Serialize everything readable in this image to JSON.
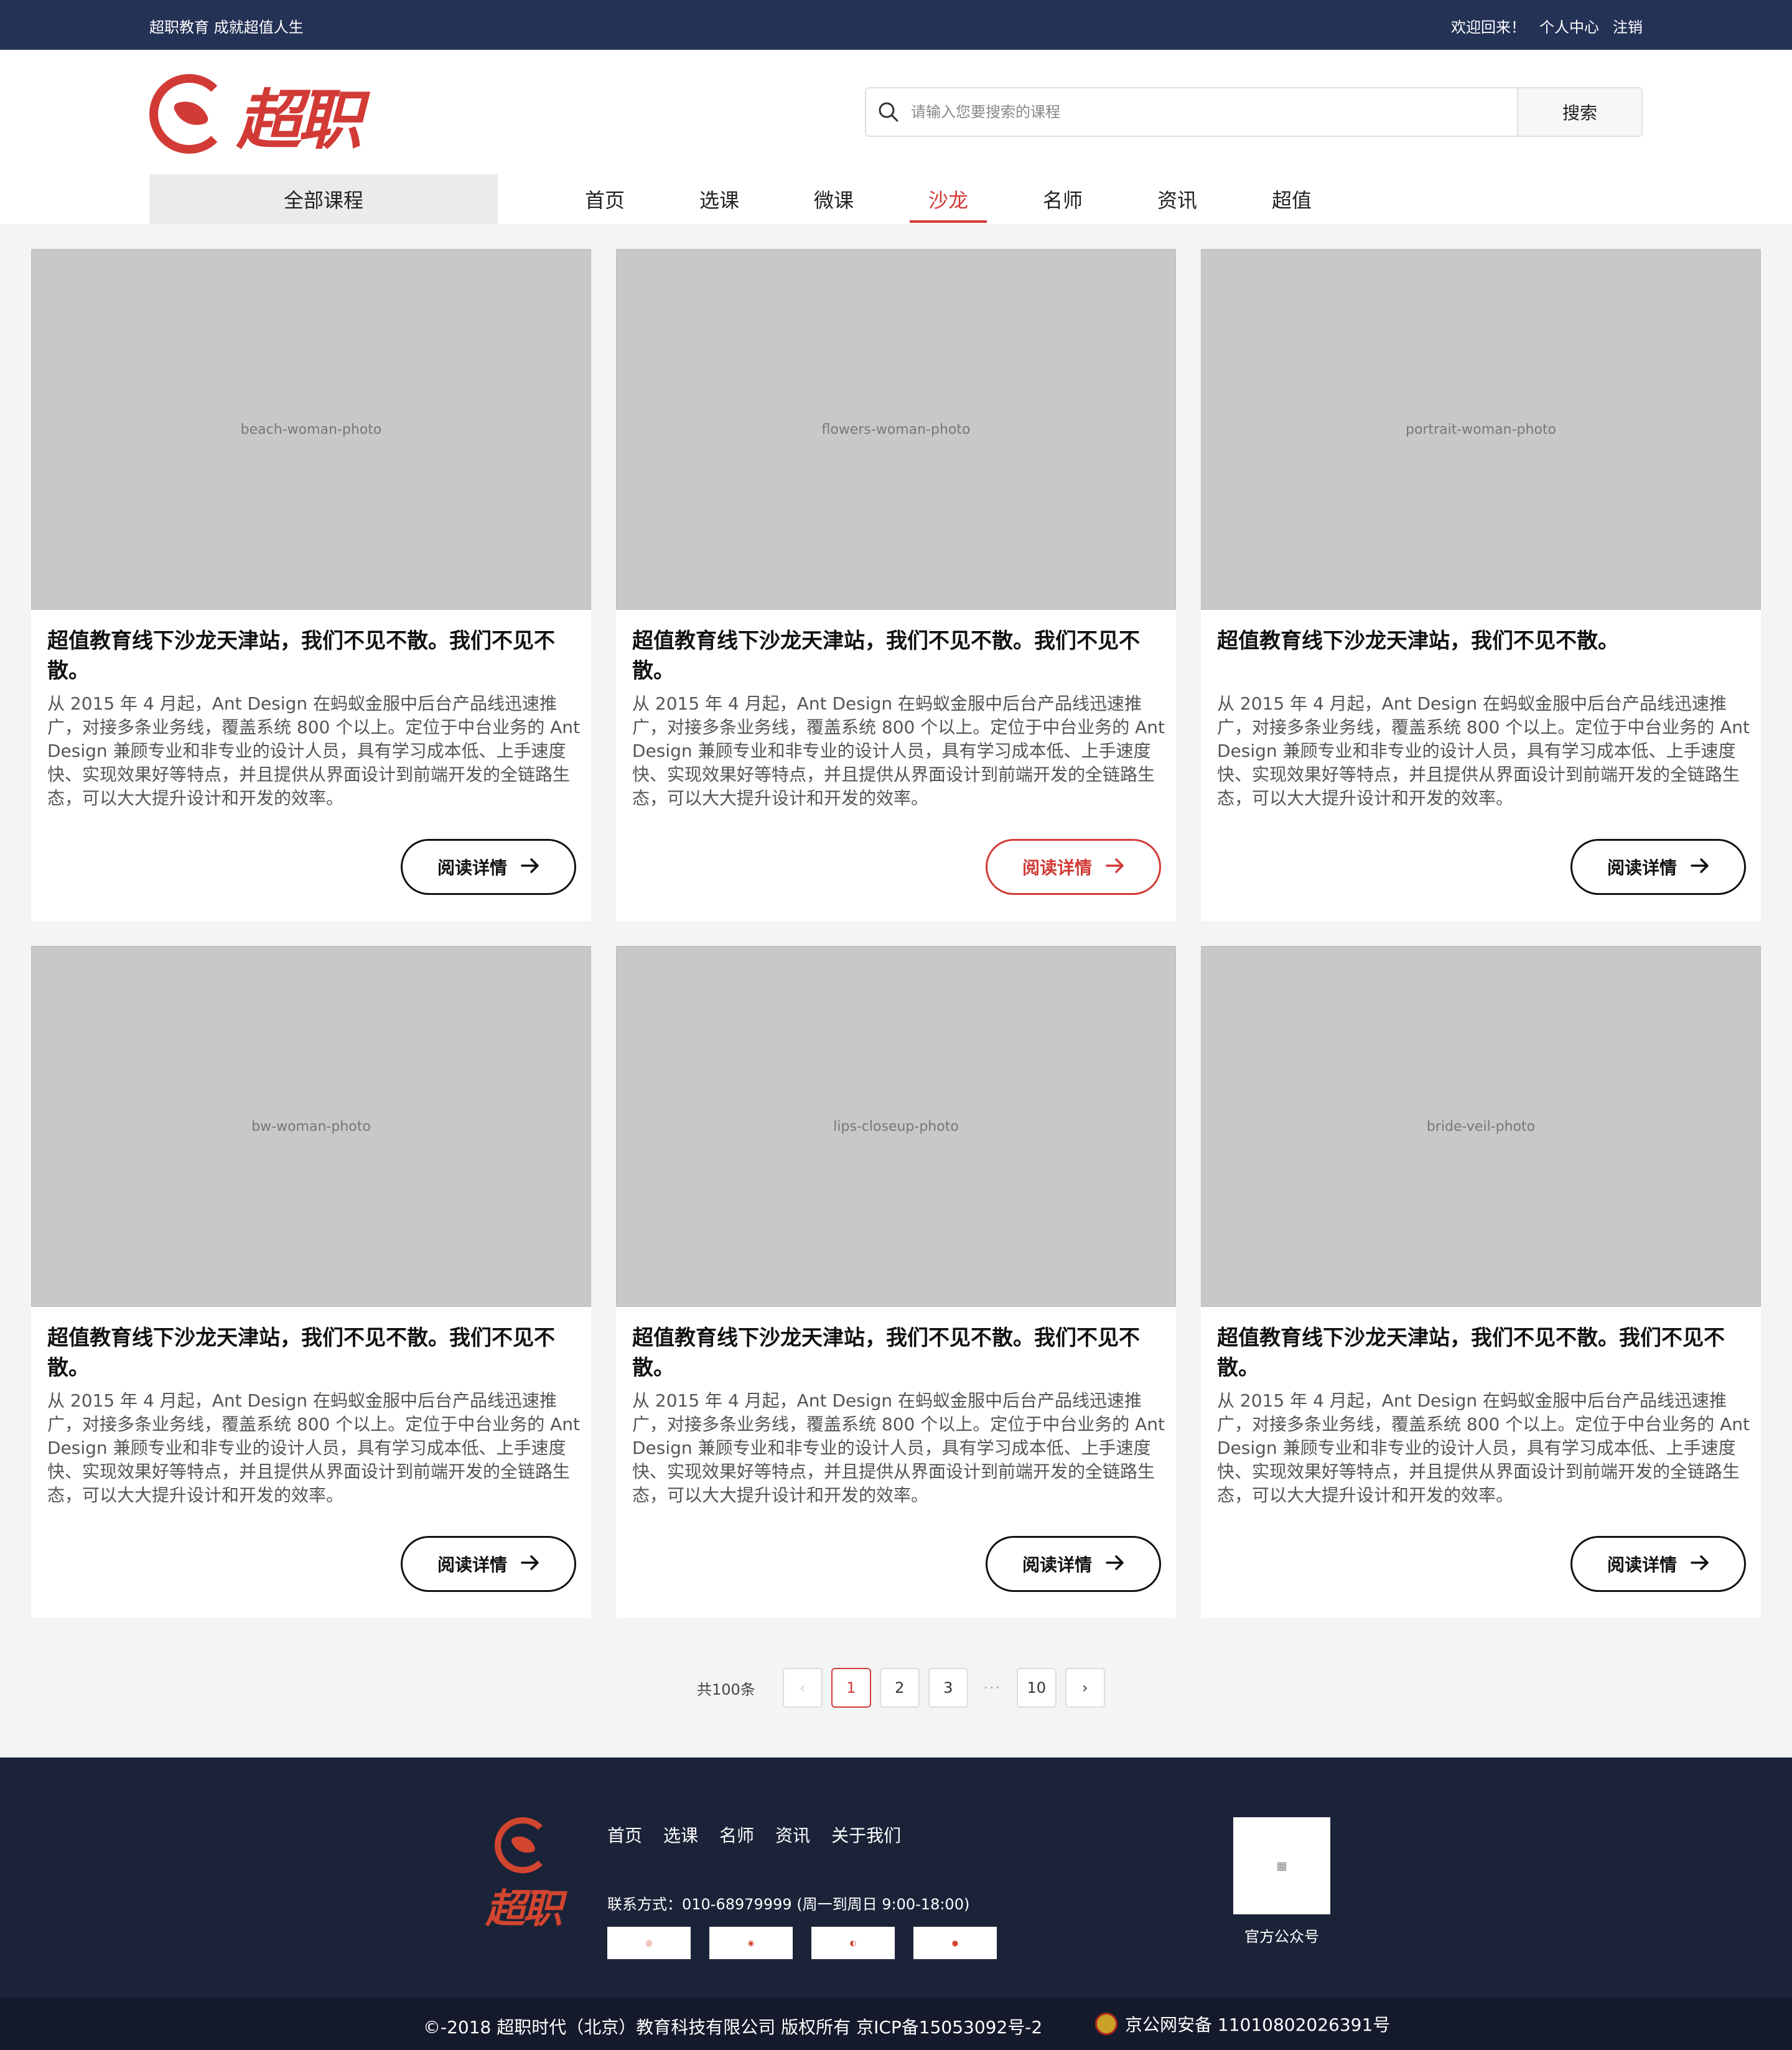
{
  "topbar": {
    "slogan": "超职教育 成就超值人生",
    "welcome": "欢迎回来！",
    "user_center": "个人中心",
    "logout": "注销"
  },
  "header": {
    "logo_text": "超职",
    "search_placeholder": "请输入您要搜索的课程",
    "search_button": "搜索",
    "all_courses": "全部课程",
    "nav": [
      "首页",
      "选课",
      "微课",
      "沙龙",
      "名师",
      "资讯",
      "超值"
    ],
    "active_nav": "沙龙"
  },
  "cards": [
    {
      "image": "beach-woman-photo",
      "title": "超值教育线下沙龙天津站，我们不见不散。我们不见不散。",
      "desc": "从 2015 年 4 月起，Ant Design 在蚂蚁金服中后台产品线迅速推广，对接多条业务线，覆盖系统 800 个以上。定位于中台业务的 Ant Design 兼顾专业和非专业的设计人员，具有学习成本低、上手速度快、实现效果好等特点，并且提供从界面设计到前端开发的全链路生态，可以大大提升设计和开发的效率。",
      "button": "阅读详情"
    },
    {
      "image": "flowers-woman-photo",
      "title": "超值教育线下沙龙天津站，我们不见不散。我们不见不散。",
      "desc": "从 2015 年 4 月起，Ant Design 在蚂蚁金服中后台产品线迅速推广，对接多条业务线，覆盖系统 800 个以上。定位于中台业务的 Ant Design 兼顾专业和非专业的设计人员，具有学习成本低、上手速度快、实现效果好等特点，并且提供从界面设计到前端开发的全链路生态，可以大大提升设计和开发的效率。",
      "button": "阅读详情"
    },
    {
      "image": "portrait-woman-photo",
      "title": "超值教育线下沙龙天津站，我们不见不散。",
      "desc": "从 2015 年 4 月起，Ant Design 在蚂蚁金服中后台产品线迅速推广，对接多条业务线，覆盖系统 800 个以上。定位于中台业务的 Ant Design 兼顾专业和非专业的设计人员，具有学习成本低、上手速度快、实现效果好等特点，并且提供从界面设计到前端开发的全链路生态，可以大大提升设计和开发的效率。",
      "button": "阅读详情"
    },
    {
      "image": "bw-woman-photo",
      "title": "超值教育线下沙龙天津站，我们不见不散。我们不见不散。",
      "desc": "从 2015 年 4 月起，Ant Design 在蚂蚁金服中后台产品线迅速推广，对接多条业务线，覆盖系统 800 个以上。定位于中台业务的 Ant Design 兼顾专业和非专业的设计人员，具有学习成本低、上手速度快、实现效果好等特点，并且提供从界面设计到前端开发的全链路生态，可以大大提升设计和开发的效率。",
      "button": "阅读详情"
    },
    {
      "image": "lips-closeup-photo",
      "title": "超值教育线下沙龙天津站，我们不见不散。我们不见不散。",
      "desc": "从 2015 年 4 月起，Ant Design 在蚂蚁金服中后台产品线迅速推广，对接多条业务线，覆盖系统 800 个以上。定位于中台业务的 Ant Design 兼顾专业和非专业的设计人员，具有学习成本低、上手速度快、实现效果好等特点，并且提供从界面设计到前端开发的全链路生态，可以大大提升设计和开发的效率。",
      "button": "阅读详情"
    },
    {
      "image": "bride-veil-photo",
      "title": "超值教育线下沙龙天津站，我们不见不散。我们不见不散。",
      "desc": "从 2015 年 4 月起，Ant Design 在蚂蚁金服中后台产品线迅速推广，对接多条业务线，覆盖系统 800 个以上。定位于中台业务的 Ant Design 兼顾专业和非专业的设计人员，具有学习成本低、上手速度快、实现效果好等特点，并且提供从界面设计到前端开发的全链路生态，可以大大提升设计和开发的效率。",
      "button": "阅读详情"
    }
  ],
  "pagination": {
    "total": "共100条",
    "pages": [
      "1",
      "2",
      "3",
      "10"
    ],
    "current": "1",
    "ellipsis": "···"
  },
  "footer": {
    "logo_text": "超职",
    "nav": [
      "首页",
      "选课",
      "名师",
      "资讯",
      "关于我们"
    ],
    "contact": "联系方式：010-68979999 (周一到周日 9:00-18:00)",
    "qr_label": "官方公众号",
    "copyright": "©-2018 超职时代（北京）教育科技有限公司 版权所有 京ICP备15053092号-2",
    "police": "京公网安备 11010802026391号"
  },
  "colors": {
    "accent": "#d23a36",
    "topbar": "#243256",
    "footer": "#1b2338"
  }
}
